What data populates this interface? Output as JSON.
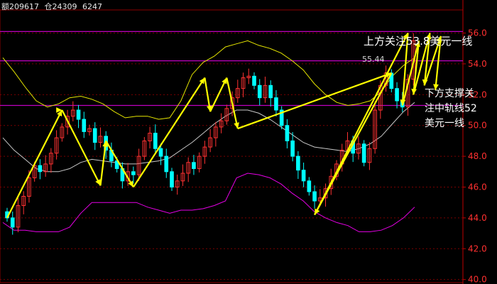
{
  "header": {
    "vol_text": "额209617",
    "oi_text": "仓24309",
    "extra_text": "6247"
  },
  "annotations": {
    "top_line": "上方关注53.8美元一线",
    "price_label": "55.44",
    "bottom_lines": [
      "下方支撑关",
      "注中轨线52",
      "美元一线"
    ]
  },
  "colors": {
    "background": "#000000",
    "up_candle": "#ff3232",
    "down_candle": "#00ffff",
    "boll_upper": "#e6e600",
    "boll_middle": "#c8c8c8",
    "boll_lower": "#e600e6",
    "hline": "#c000c0",
    "arrow": "#ffff00",
    "axis_text": "#ff3030"
  },
  "chart_data": {
    "type": "candlestick",
    "ylim": [
      39.8,
      57.5
    ],
    "yticks": [
      "40.0",
      "42.0",
      "44.0",
      "46.0",
      "48.0",
      "50.0",
      "52.0",
      "54.0",
      "56.0"
    ],
    "horizontal_lines": [
      56.1,
      54.2,
      51.3
    ],
    "closes": [
      44.0,
      43.4,
      44.8,
      45.4,
      46.6,
      47.4,
      47.0,
      47.5,
      48.2,
      49.2,
      49.9,
      50.6,
      51.0,
      50.4,
      49.6,
      49.8,
      48.9,
      49.3,
      48.4,
      47.7,
      47.2,
      46.4,
      47.0,
      46.8,
      48.0,
      49.0,
      49.5,
      48.5,
      48.0,
      47.0,
      46.0,
      46.4,
      46.9,
      47.6,
      47.2,
      48.0,
      48.6,
      49.2,
      49.9,
      50.3,
      51.1,
      51.8,
      52.4,
      53.1,
      53.2,
      52.6,
      51.8,
      52.6,
      51.8,
      51.0,
      50.0,
      49.0,
      48.0,
      47.1,
      46.4,
      45.7,
      45.1,
      45.3,
      45.9,
      46.7,
      47.5,
      48.4,
      49.0,
      48.2,
      48.8,
      47.6,
      48.5,
      51.0,
      52.6,
      53.4,
      52.4,
      51.6,
      51.2,
      53.0,
      55.5
    ],
    "boll_upper": [
      54.4,
      53.5,
      52.5,
      51.6,
      51.2,
      51.4,
      51.8,
      51.9,
      51.7,
      51.4,
      50.9,
      50.5,
      50.6,
      50.6,
      50.4,
      50.5,
      51.6,
      53.3,
      54.1,
      54.5,
      55.1,
      55.3,
      55.5,
      55.2,
      55.0,
      54.7,
      54.2,
      53.6,
      52.7,
      52.0,
      51.5,
      51.3,
      51.4,
      51.6,
      52.2,
      53.2,
      53.9,
      54.4
    ],
    "boll_middle": [
      49.2,
      48.4,
      47.8,
      47.2,
      47.0,
      47.0,
      47.2,
      47.6,
      47.8,
      47.7,
      47.6,
      47.5,
      47.5,
      47.6,
      47.7,
      47.9,
      48.4,
      48.9,
      49.5,
      50.1,
      50.6,
      51.0,
      51.0,
      50.8,
      50.4,
      49.9,
      49.4,
      48.9,
      48.6,
      48.5,
      48.4,
      48.3,
      48.5,
      48.8,
      49.3,
      50.1,
      50.9,
      51.5
    ],
    "boll_lower": [
      43.7,
      43.2,
      43.2,
      43.1,
      43.1,
      43.1,
      43.4,
      44.3,
      45.0,
      45.0,
      45.0,
      45.0,
      45.0,
      44.7,
      44.5,
      44.3,
      44.5,
      44.5,
      44.6,
      44.8,
      45.1,
      46.6,
      46.9,
      46.8,
      46.6,
      46.2,
      45.6,
      45.1,
      44.4,
      44.0,
      43.7,
      43.5,
      43.1,
      43.1,
      43.2,
      43.5,
      44.0,
      44.7
    ],
    "arrows_up": [
      [
        0,
        44.0
      ],
      [
        10,
        51.0
      ],
      [
        18,
        49.0
      ],
      [
        36,
        53.1
      ],
      [
        40,
        53.1
      ],
      [
        70,
        53.4
      ],
      [
        73,
        56.0
      ],
      [
        75,
        55.5
      ],
      [
        77,
        56.0
      ],
      [
        79,
        55.8
      ]
    ],
    "arrows_down": [
      [
        10,
        51.0
      ],
      [
        17,
        46.1
      ],
      [
        23,
        46.0
      ],
      [
        37,
        50.9
      ],
      [
        42,
        49.8
      ],
      [
        56,
        44.2
      ],
      [
        72,
        51.3
      ],
      [
        74,
        52.0
      ],
      [
        76,
        52.6
      ],
      [
        78,
        52.3
      ]
    ]
  }
}
